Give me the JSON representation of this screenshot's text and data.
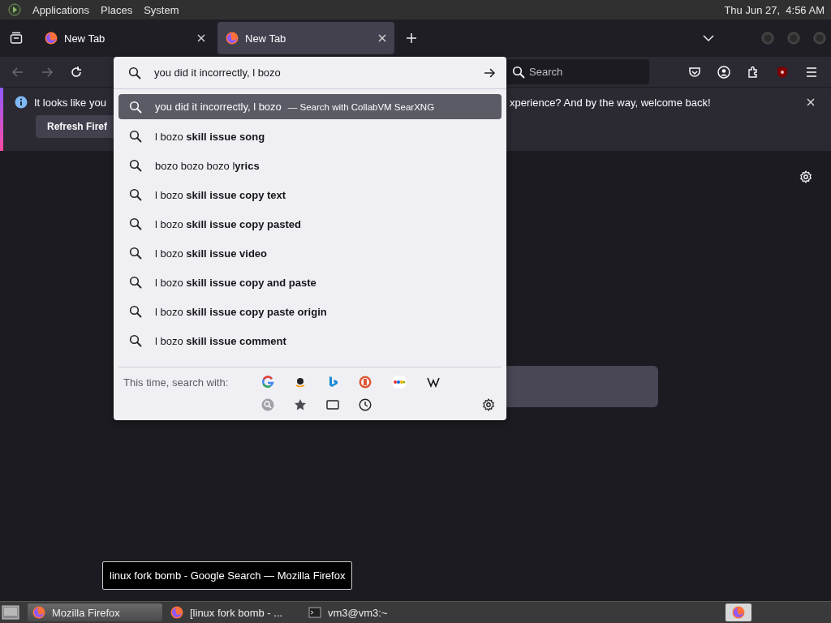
{
  "top_panel": {
    "menus": [
      "Applications",
      "Places",
      "System"
    ],
    "clock": "Thu Jun 27,  4:56 AM"
  },
  "tabs": [
    {
      "label": "New Tab",
      "selected": false
    },
    {
      "label": "New Tab",
      "selected": true
    }
  ],
  "search_bar": {
    "placeholder": "Search"
  },
  "notification": {
    "text_start": "It looks like you",
    "text_end": "xperience? And by the way, welcome back!",
    "button": "Refresh Firef"
  },
  "url_popup": {
    "value": "you did it incorrectly, l bozo",
    "results": [
      {
        "text": "you did it incorrectly, l bozo",
        "action": "— Search with CollabVM SearXNG",
        "selected": true
      },
      {
        "text": "l bozo **skill issue song**",
        "selected": false
      },
      {
        "text": "bozo bozo bozo l**yrics**",
        "selected": false
      },
      {
        "text": "l bozo **skill issue copy text**",
        "selected": false
      },
      {
        "text": "l bozo **skill issue copy pasted**",
        "selected": false
      },
      {
        "text": "l bozo **skill issue video**",
        "selected": false
      },
      {
        "text": "l bozo **skill issue copy and paste**",
        "selected": false
      },
      {
        "text": "l bozo **skill issue copy paste origin**",
        "selected": false
      },
      {
        "text": "l bozo **skill issue comment**",
        "selected": false
      }
    ],
    "footer_label": "This time, search with:"
  },
  "tooltip": "linux fork bomb - Google Search — Mozilla Firefox",
  "taskbar": {
    "tasks": [
      {
        "label": "Mozilla Firefox",
        "selected": true,
        "kind": "firefox"
      },
      {
        "label": "[linux fork bomb - ...",
        "selected": false,
        "kind": "firefox"
      },
      {
        "label": "vm3@vm3:~",
        "selected": false,
        "kind": "terminal"
      }
    ]
  }
}
